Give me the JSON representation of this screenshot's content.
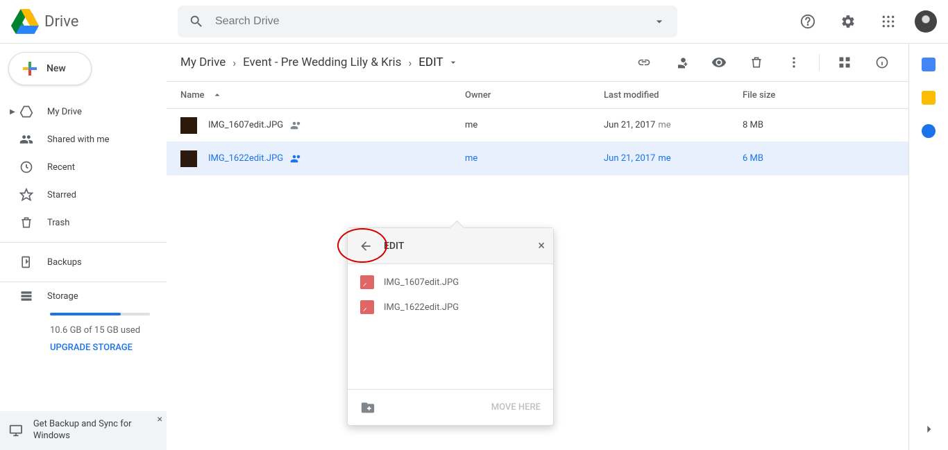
{
  "header": {
    "app_name": "Drive",
    "search_placeholder": "Search Drive"
  },
  "new_button": "New",
  "nav": {
    "my_drive": "My Drive",
    "shared": "Shared with me",
    "recent": "Recent",
    "starred": "Starred",
    "trash": "Trash",
    "backups": "Backups",
    "storage": "Storage",
    "storage_used": "10.6 GB of 15 GB used",
    "upgrade": "UPGRADE STORAGE"
  },
  "banner": {
    "text": "Get Backup and Sync for Windows"
  },
  "breadcrumb": {
    "root": "My Drive",
    "folder1": "Event - Pre Wedding Lily & Kris",
    "current": "EDIT"
  },
  "columns": {
    "name": "Name",
    "owner": "Owner",
    "modified": "Last modified",
    "size": "File size"
  },
  "files": [
    {
      "name": "IMG_1607edit.JPG",
      "owner": "me",
      "modified": "Jun 21, 2017",
      "mod_by": "me",
      "size": "8 MB",
      "selected": false
    },
    {
      "name": "IMG_1622edit.JPG",
      "owner": "me",
      "modified": "Jun 21, 2017",
      "mod_by": "me",
      "size": "6 MB",
      "selected": true
    }
  ],
  "move_popup": {
    "title": "EDIT",
    "items": [
      "IMG_1607edit.JPG",
      "IMG_1622edit.JPG"
    ],
    "action": "MOVE HERE"
  }
}
